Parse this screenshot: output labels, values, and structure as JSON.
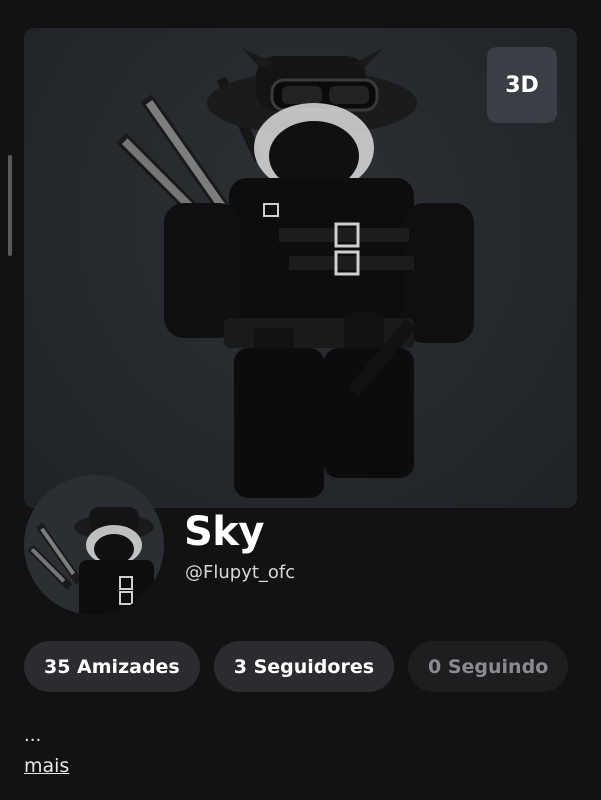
{
  "profile": {
    "display_name": "Sky",
    "username": "@Flupyt_ofc",
    "view_toggle_label": "3D",
    "bio_text": "...",
    "more_label": "mais"
  },
  "stats": [
    {
      "label": "35 Amizades"
    },
    {
      "label": "3 Seguidores"
    },
    {
      "label": "0 Seguindo"
    }
  ],
  "colors": {
    "background": "#121212",
    "hero_background": "#26292d",
    "pill_background": "#2b2c2f",
    "pill_muted_text": "#8a8b8f"
  },
  "icons": {
    "avatar_render": "avatar-3d-render",
    "profile_thumbnail": "avatar-headshot"
  }
}
